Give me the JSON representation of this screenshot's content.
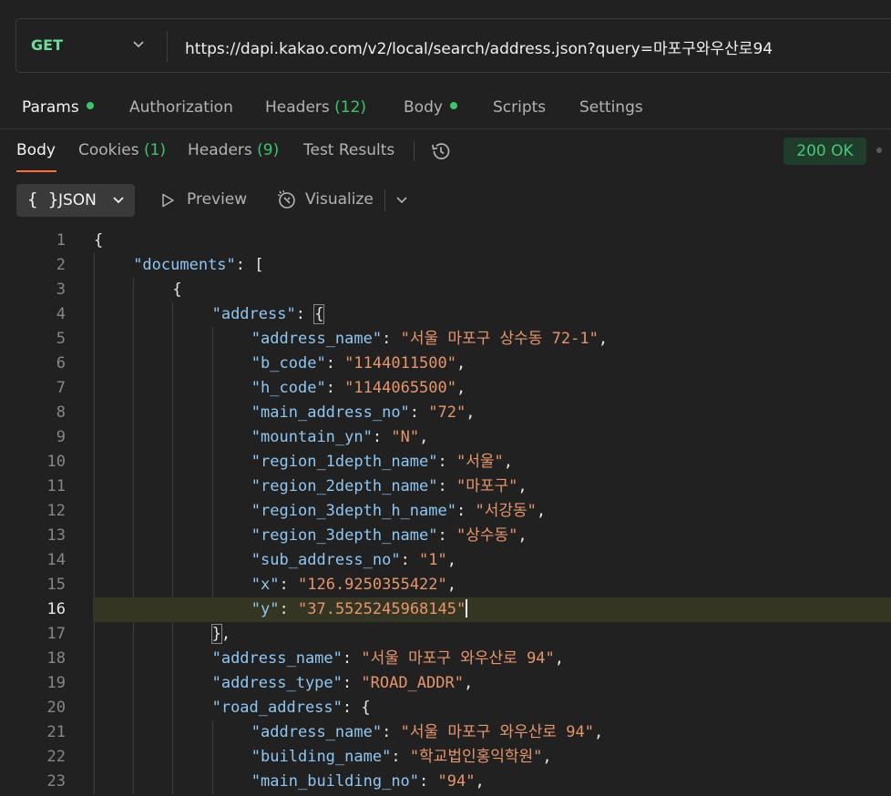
{
  "request": {
    "method": "GET",
    "url": "https://dapi.kakao.com/v2/local/search/address.json?query=마포구와우산로94"
  },
  "request_tabs": [
    {
      "label": "Params",
      "dot": true
    },
    {
      "label": "Authorization"
    },
    {
      "label": "Headers",
      "count": "(12)"
    },
    {
      "label": "Body",
      "dot": true
    },
    {
      "label": "Scripts"
    },
    {
      "label": "Settings"
    }
  ],
  "response_tabs": [
    {
      "label": "Body"
    },
    {
      "label": "Cookies",
      "count": "(1)"
    },
    {
      "label": "Headers",
      "count": "(9)"
    },
    {
      "label": "Test Results"
    }
  ],
  "status": "200 OK",
  "format": {
    "braces": "{ }",
    "selected": "JSON",
    "preview_label": "Preview",
    "visualize_label": "Visualize"
  },
  "icons": {
    "method_dropdown": "chevron-down-icon",
    "history": "history-icon",
    "preview": "play-outline-icon",
    "visualize": "visualize-icon",
    "format_dropdown": "chevron-down-icon"
  },
  "colors": {
    "background": "#212121",
    "method": "#6bdd9a",
    "accent": "#ff6c37",
    "key": "#8fc6f2",
    "string": "#e6956c",
    "status_ok": "#46c878"
  },
  "editor": {
    "current_line": 16,
    "lines": [
      {
        "n": 1,
        "indent": 0,
        "pre": "{"
      },
      {
        "n": 2,
        "indent": 1,
        "key": "documents",
        "post": ": ["
      },
      {
        "n": 3,
        "indent": 2,
        "pre": "{"
      },
      {
        "n": 4,
        "indent": 3,
        "key": "address",
        "post": ": {"
      },
      {
        "n": 5,
        "indent": 4,
        "key": "address_name",
        "value": "서울 마포구 상수동 72-1",
        "post": ","
      },
      {
        "n": 6,
        "indent": 4,
        "key": "b_code",
        "value": "1144011500",
        "post": ","
      },
      {
        "n": 7,
        "indent": 4,
        "key": "h_code",
        "value": "1144065500",
        "post": ","
      },
      {
        "n": 8,
        "indent": 4,
        "key": "main_address_no",
        "value": "72",
        "post": ","
      },
      {
        "n": 9,
        "indent": 4,
        "key": "mountain_yn",
        "value": "N",
        "post": ","
      },
      {
        "n": 10,
        "indent": 4,
        "key": "region_1depth_name",
        "value": "서울",
        "post": ","
      },
      {
        "n": 11,
        "indent": 4,
        "key": "region_2depth_name",
        "value": "마포구",
        "post": ","
      },
      {
        "n": 12,
        "indent": 4,
        "key": "region_3depth_h_name",
        "value": "서강동",
        "post": ","
      },
      {
        "n": 13,
        "indent": 4,
        "key": "region_3depth_name",
        "value": "상수동",
        "post": ","
      },
      {
        "n": 14,
        "indent": 4,
        "key": "sub_address_no",
        "value": "1",
        "post": ","
      },
      {
        "n": 15,
        "indent": 4,
        "key": "x",
        "value": "126.9250355422",
        "post": ","
      },
      {
        "n": 16,
        "indent": 4,
        "key": "y",
        "value": "37.5525245968145",
        "post": ""
      },
      {
        "n": 17,
        "indent": 3,
        "pre": "},"
      },
      {
        "n": 18,
        "indent": 3,
        "key": "address_name",
        "value": "서울 마포구 와우산로 94",
        "post": ","
      },
      {
        "n": 19,
        "indent": 3,
        "key": "address_type",
        "value": "ROAD_ADDR",
        "post": ","
      },
      {
        "n": 20,
        "indent": 3,
        "key": "road_address",
        "post": ": {"
      },
      {
        "n": 21,
        "indent": 4,
        "key": "address_name",
        "value": "서울 마포구 와우산로 94",
        "post": ","
      },
      {
        "n": 22,
        "indent": 4,
        "key": "building_name",
        "value": "학교법인홍익학원",
        "post": ","
      },
      {
        "n": 23,
        "indent": 4,
        "key": "main_building_no",
        "value": "94",
        "post": ","
      }
    ]
  }
}
